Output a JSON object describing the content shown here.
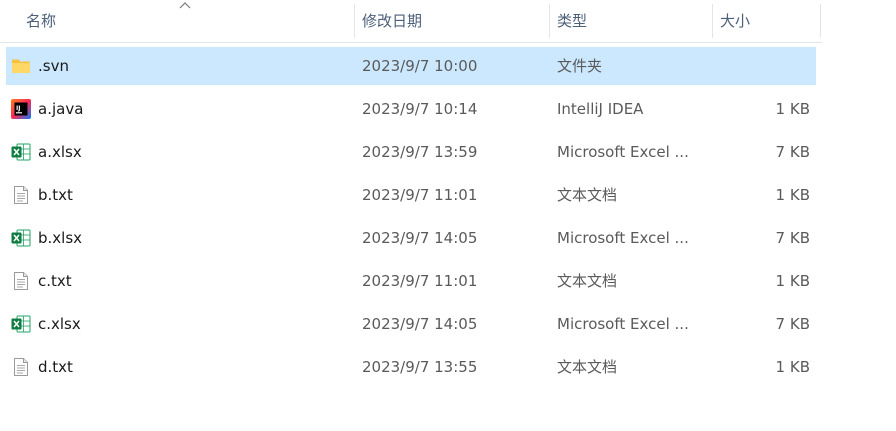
{
  "columns": {
    "name": "名称",
    "date": "修改日期",
    "type": "类型",
    "size": "大小"
  },
  "files": [
    {
      "name": ".svn",
      "date": "2023/9/7 10:00",
      "type": "文件夹",
      "size": "",
      "icon": "folder-icon",
      "selected": true
    },
    {
      "name": "a.java",
      "date": "2023/9/7 10:14",
      "type": "IntelliJ IDEA",
      "size": "1 KB",
      "icon": "intellij-icon"
    },
    {
      "name": "a.xlsx",
      "date": "2023/9/7 13:59",
      "type": "Microsoft Excel ...",
      "size": "7 KB",
      "icon": "excel-icon"
    },
    {
      "name": "b.txt",
      "date": "2023/9/7 11:01",
      "type": "文本文档",
      "size": "1 KB",
      "icon": "text-file-icon"
    },
    {
      "name": "b.xlsx",
      "date": "2023/9/7 14:05",
      "type": "Microsoft Excel ...",
      "size": "7 KB",
      "icon": "excel-icon"
    },
    {
      "name": "c.txt",
      "date": "2023/9/7 11:01",
      "type": "文本文档",
      "size": "1 KB",
      "icon": "text-file-icon"
    },
    {
      "name": "c.xlsx",
      "date": "2023/9/7 14:05",
      "type": "Microsoft Excel ...",
      "size": "7 KB",
      "icon": "excel-icon"
    },
    {
      "name": "d.txt",
      "date": "2023/9/7 13:55",
      "type": "文本文档",
      "size": "1 KB",
      "icon": "text-file-icon"
    }
  ],
  "colors": {
    "selected_row": "#cce8ff",
    "header_text": "#4c607a",
    "excel_green": "#107c41",
    "folder_yellow": "#ffc83d"
  }
}
